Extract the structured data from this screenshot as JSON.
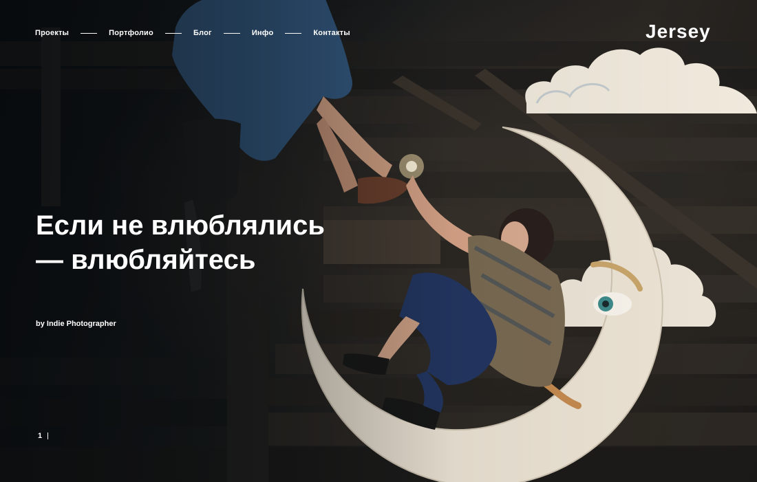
{
  "nav": {
    "items": [
      {
        "label": "Проекты"
      },
      {
        "label": "Портфолио"
      },
      {
        "label": "Блог"
      },
      {
        "label": "Инфо"
      },
      {
        "label": "Контакты"
      }
    ]
  },
  "brand": {
    "logo_text": "Jersey"
  },
  "hero": {
    "headline_line1": "Если не влюблялись",
    "headline_line2": "— влюбляйтесь",
    "byline": "by Indie Photographer",
    "image_icon": "moon-photo"
  },
  "pager": {
    "current": "1"
  },
  "colors": {
    "text": "#ffffff",
    "background": "#0f1214"
  }
}
